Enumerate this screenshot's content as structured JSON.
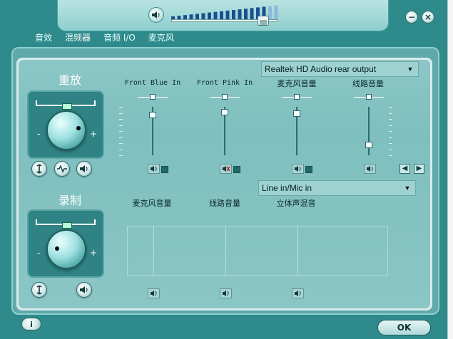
{
  "master_volume": {
    "level": 0.85
  },
  "titlebar": {
    "minimize": "−",
    "close": "×"
  },
  "tabs": [
    {
      "label": "音效"
    },
    {
      "label": "混频器"
    },
    {
      "label": "音频 I/O"
    },
    {
      "label": "麦克风"
    }
  ],
  "playback": {
    "title": "重放",
    "output_device": "Realtek HD Audio rear output",
    "knob": {
      "minus": "-",
      "plus": "+"
    },
    "channels": [
      {
        "label": "Front Blue In",
        "level": 0.9,
        "muted": false
      },
      {
        "label": "Front Pink In",
        "level": 0.95,
        "muted": true
      },
      {
        "label": "麦克风音量",
        "level": 0.93,
        "muted": false
      },
      {
        "label": "线路音量",
        "level": 0.28,
        "muted": false
      }
    ]
  },
  "recording": {
    "title": "录制",
    "input_device": "Line in/Mic in",
    "knob": {
      "minus": "-",
      "plus": "+"
    },
    "channels": [
      {
        "label": "麦克风音量"
      },
      {
        "label": "线路音量"
      },
      {
        "label": "立体声混音"
      }
    ]
  },
  "footer": {
    "info": "i",
    "ok": "OK"
  },
  "colors": {
    "frame": "#2f8a8c",
    "panel": "#7fbfbf",
    "accent": "#b6ffda"
  },
  "icons": [
    "speaker-icon",
    "mute-speaker-icon",
    "wrench-icon",
    "wave-icon",
    "info-icon"
  ]
}
